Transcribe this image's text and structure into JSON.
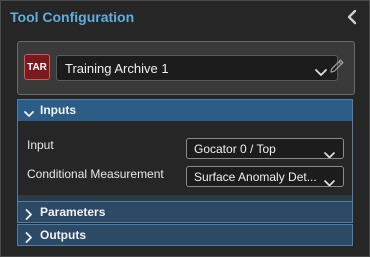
{
  "panel": {
    "title": "Tool Configuration",
    "collapse_icon": "chevron-left-icon"
  },
  "tool": {
    "badge": "TAR",
    "selected": "Training Archive 1",
    "edit_icon": "pencil-icon"
  },
  "sections": {
    "inputs": {
      "title": "Inputs",
      "expanded": true,
      "fields": [
        {
          "label": "Input",
          "value": "Gocator 0 / Top"
        },
        {
          "label": "Conditional Measurement",
          "value": "Surface Anomaly Det..."
        }
      ]
    },
    "parameters": {
      "title": "Parameters",
      "expanded": false
    },
    "outputs": {
      "title": "Outputs",
      "expanded": false
    }
  },
  "colors": {
    "accent": "#5eaee0",
    "section_header": "#2c5d86",
    "badge": "#7a1a1e"
  }
}
